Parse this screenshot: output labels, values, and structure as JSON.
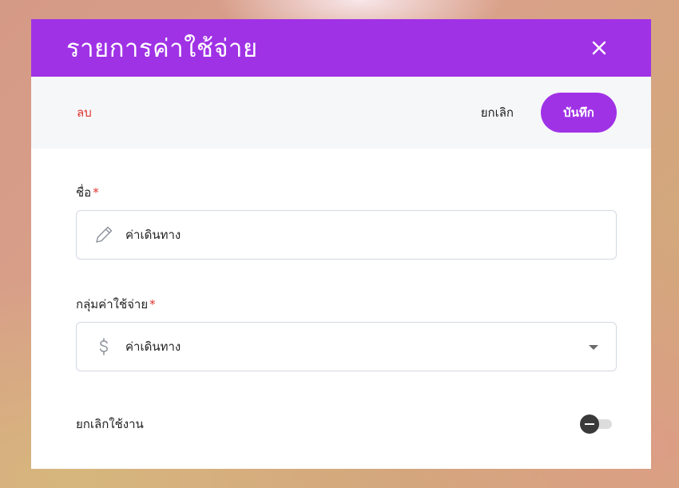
{
  "dialog": {
    "title": "รายการค่าใช้จ่าย",
    "close_icon": "close-icon"
  },
  "toolbar": {
    "delete_label": "ลบ",
    "cancel_label": "ยกเลิก",
    "save_label": "บันทึก"
  },
  "form": {
    "name": {
      "label": "ชื่อ",
      "required_mark": "*",
      "icon": "pencil-icon",
      "value": "ค่าเดินทาง"
    },
    "expense_group": {
      "label": "กลุ่มค่าใช้จ่าย",
      "required_mark": "*",
      "icon": "dollar-icon",
      "value": "ค่าเดินทาง"
    },
    "disable": {
      "label": "ยกเลิกใช้งาน",
      "enabled": false
    }
  },
  "colors": {
    "brand": "#a032e6",
    "danger": "#e0342f",
    "toolbar_bg": "#f6f7f9",
    "border": "#d3d8e2"
  }
}
